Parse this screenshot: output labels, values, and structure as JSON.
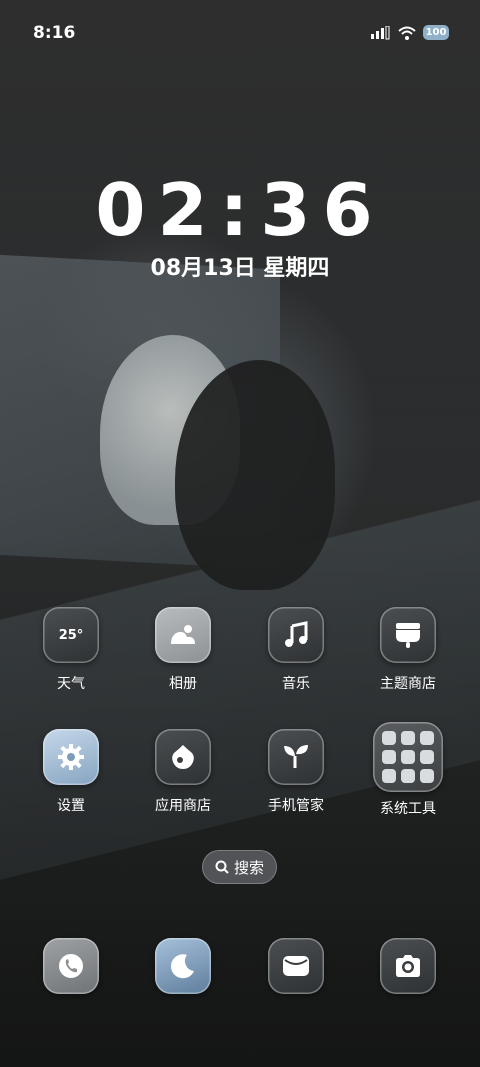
{
  "status_bar": {
    "time": "8:16",
    "battery": "100",
    "icons": [
      "signal-icon",
      "wifi-icon",
      "battery-icon"
    ]
  },
  "clock": {
    "time": "02:36",
    "date": "08月13日 星期四"
  },
  "apps": [
    {
      "label": "天气",
      "icon": "weather-icon",
      "tile_text": "25°"
    },
    {
      "label": "相册",
      "icon": "gallery-icon"
    },
    {
      "label": "音乐",
      "icon": "music-icon"
    },
    {
      "label": "主题商店",
      "icon": "theme-store-icon"
    },
    {
      "label": "设置",
      "icon": "gear-icon"
    },
    {
      "label": "应用商店",
      "icon": "app-store-icon"
    },
    {
      "label": "手机管家",
      "icon": "phone-manager-icon"
    },
    {
      "label": "系统工具",
      "icon": "folder-icon"
    }
  ],
  "search": {
    "label": "搜索"
  },
  "dock": [
    {
      "icon": "phone-icon"
    },
    {
      "icon": "moon-icon"
    },
    {
      "icon": "message-icon"
    },
    {
      "icon": "camera-icon"
    }
  ]
}
